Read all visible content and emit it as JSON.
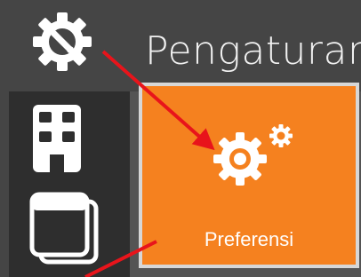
{
  "header": {
    "title": "Pengaturan",
    "settings_icon": "gear-wrench-icon"
  },
  "sidebar": {
    "items": [
      {
        "icon": "building-icon"
      },
      {
        "icon": "windows-stack-icon"
      }
    ]
  },
  "tile": {
    "label": "Preferensi",
    "icon": "gears-icon"
  },
  "colors": {
    "tile_bg": "#f5811f",
    "header_bg": "#454545",
    "sidebar_bg": "#2e2e2e",
    "annotation_arrow": "#e8141b"
  }
}
